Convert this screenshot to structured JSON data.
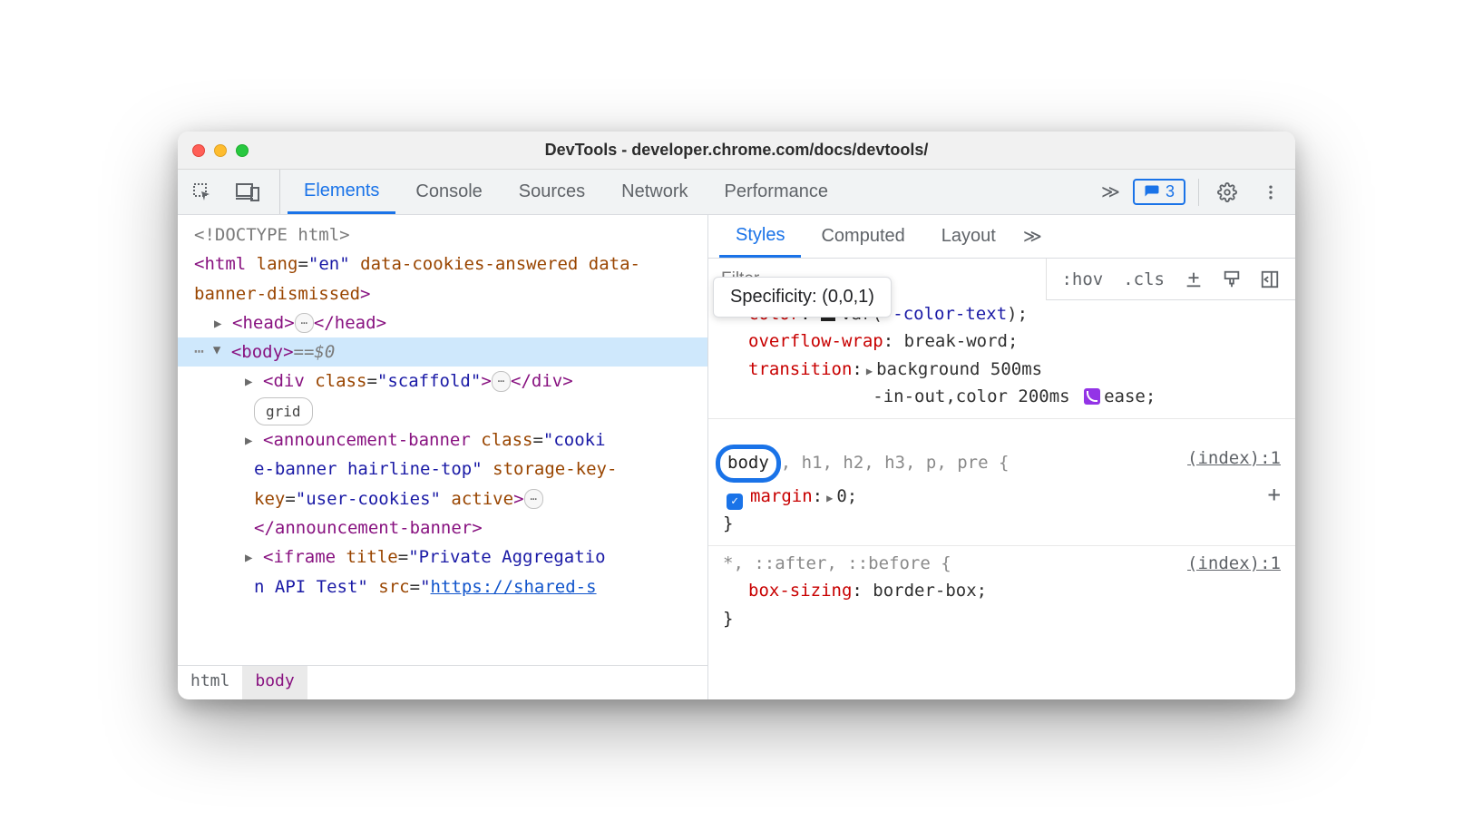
{
  "window": {
    "title": "DevTools - developer.chrome.com/docs/devtools/"
  },
  "toolbar": {
    "tabs": [
      "Elements",
      "Console",
      "Sources",
      "Network",
      "Performance"
    ],
    "active_tab": "Elements",
    "overflow": "≫",
    "issues_count": "3"
  },
  "dom": {
    "doctype": "<!DOCTYPE html>",
    "html_open": {
      "lang": "en",
      "attrs": "data-cookies-answered data-banner-dismissed"
    },
    "head": {
      "open": "head",
      "close": "head"
    },
    "body_selected": {
      "tag": "body",
      "eq": " == ",
      "dollar": "$0"
    },
    "scaffold": {
      "tag": "div",
      "class_attr": "class",
      "class_val": "scaffold",
      "close": "div"
    },
    "grid_pill": "grid",
    "banner": {
      "tag": "announcement-banner",
      "class_attr": "class",
      "class_val_l1": "cooki",
      "class_val_l2": "e-banner hairline-top",
      "sk_attr": "storage-key",
      "sk_val": "user-cookies",
      "active": "active",
      "close": "announcement-banner"
    },
    "iframe": {
      "tag": "iframe",
      "title_attr": "title",
      "title_val_l1": "Private Aggregatio",
      "title_val_l2": "n API Test",
      "src_attr": "src",
      "src_val": "https://shared-s"
    }
  },
  "crumbs": [
    "html",
    "body"
  ],
  "right_tabs": {
    "items": [
      "Styles",
      "Computed",
      "Layout"
    ],
    "active": "Styles",
    "overflow": "≫"
  },
  "filter": {
    "placeholder": "Filter",
    "hov": ":hov",
    "cls": ".cls"
  },
  "styles": {
    "rule0": {
      "color_prop": "color",
      "color_val_prefix": "var(",
      "color_var": "--color-text",
      "color_val_suffix": ");",
      "ow_prop": "overflow-wrap",
      "ow_val": "break-word;",
      "tr_prop": "transition",
      "tr_l1": "background 500ms",
      "tr_l2a": "-in-out,color 200ms",
      "tr_l2b": "ease;"
    },
    "rule1": {
      "selector_first": "body",
      "selector_rest": ", h1, h2, h3, p, pre {",
      "src": "(index):1",
      "margin_prop": "margin",
      "margin_val": "0;",
      "close": "}"
    },
    "rule2": {
      "selector": "*, ::after, ::before {",
      "src": "(index):1",
      "bs_prop": "box-sizing",
      "bs_val": "border-box;",
      "close": "}"
    }
  },
  "tooltip": {
    "label": "Specificity:",
    "value": "(0,0,1)"
  }
}
